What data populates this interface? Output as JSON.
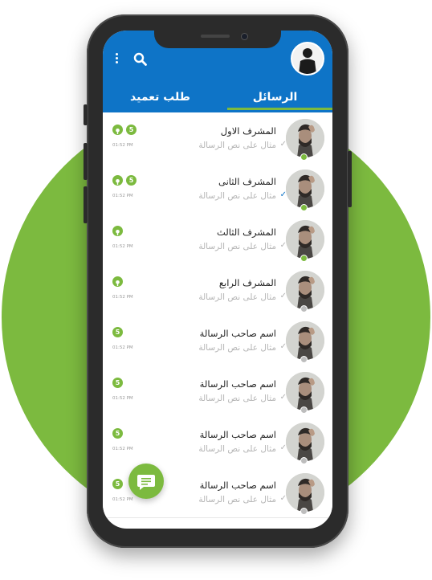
{
  "header": {
    "tabs": [
      {
        "label": "طلب تعميد"
      },
      {
        "label": "الرسائل",
        "active": true
      }
    ],
    "icons": [
      "more-vert-icon",
      "search-icon"
    ]
  },
  "fab": {
    "icon": "chat-icon"
  },
  "colors": {
    "primary": "#0e74c7",
    "accent": "#7cba3f",
    "online": "#7cba3f",
    "offline": "#bdbdbd",
    "read_check": "#0e74c7"
  },
  "messages": [
    {
      "name": "المشرف الاول",
      "preview": "مثال على نص الرسالة",
      "time": "01:52 PM",
      "unread": "5",
      "pinned": true,
      "online": true,
      "read": false
    },
    {
      "name": "المشرف الثانى",
      "preview": "مثال على نص الرسالة",
      "time": "01:52 PM",
      "unread": "5",
      "pinned": true,
      "online": true,
      "read": true
    },
    {
      "name": "المشرف الثالث",
      "preview": "مثال على نص الرسالة",
      "time": "01:52 PM",
      "unread": "",
      "pinned": true,
      "online": true,
      "read": false
    },
    {
      "name": "المشرف الرابع",
      "preview": "مثال على نص الرسالة",
      "time": "01:52 PM",
      "unread": "",
      "pinned": true,
      "online": false,
      "read": false
    },
    {
      "name": "اسم صاحب الرسالة",
      "preview": "مثال على نص الرسالة",
      "time": "01:52 PM",
      "unread": "5",
      "pinned": false,
      "online": false,
      "read": false
    },
    {
      "name": "اسم صاحب الرسالة",
      "preview": "مثال على نص الرسالة",
      "time": "01:52 PM",
      "unread": "5",
      "pinned": false,
      "online": false,
      "read": false
    },
    {
      "name": "اسم صاحب الرسالة",
      "preview": "مثال على نص الرسالة",
      "time": "01:52 PM",
      "unread": "5",
      "pinned": false,
      "online": false,
      "read": false
    },
    {
      "name": "اسم صاحب الرسالة",
      "preview": "مثال على نص الرسالة",
      "time": "01:52 PM",
      "unread": "5",
      "pinned": false,
      "online": false,
      "read": false
    }
  ]
}
